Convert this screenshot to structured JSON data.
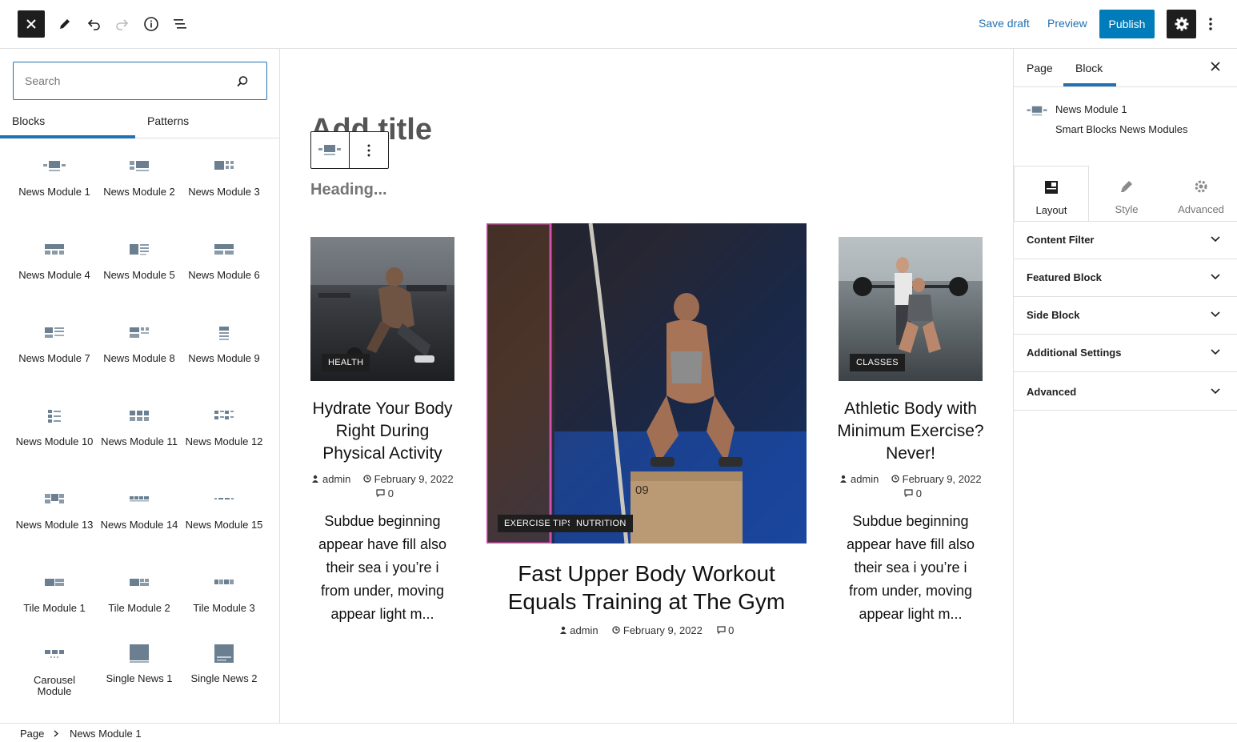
{
  "topbar": {
    "save_draft": "Save draft",
    "preview": "Preview",
    "publish": "Publish"
  },
  "inserter": {
    "search_placeholder": "Search",
    "tabs": [
      "Blocks",
      "Patterns"
    ],
    "blocks": [
      {
        "label": "News Module 1"
      },
      {
        "label": "News Module 2"
      },
      {
        "label": "News Module 3"
      },
      {
        "label": "News Module 4"
      },
      {
        "label": "News Module 5"
      },
      {
        "label": "News Module 6"
      },
      {
        "label": "News Module 7"
      },
      {
        "label": "News Module 8"
      },
      {
        "label": "News Module 9"
      },
      {
        "label": "News Module 10"
      },
      {
        "label": "News Module 11"
      },
      {
        "label": "News Module 12"
      },
      {
        "label": "News Module 13"
      },
      {
        "label": "News Module 14"
      },
      {
        "label": "News Module 15"
      },
      {
        "label": "Tile Module 1"
      },
      {
        "label": "Tile Module 2"
      },
      {
        "label": "Tile Module 3"
      },
      {
        "label": "Carousel Module"
      },
      {
        "label": "Single News 1"
      },
      {
        "label": "Single News 2"
      }
    ]
  },
  "canvas": {
    "title_placeholder": "Add title",
    "heading_placeholder": "Heading...",
    "posts": [
      {
        "category": "HEALTH",
        "title": "Hydrate Your Body Right During Physical Activity",
        "author": "admin",
        "date": "February 9, 2022",
        "comments": "0",
        "excerpt": "Subdue beginning appear have fill also their sea i you’re i from under, moving appear light m..."
      },
      {
        "categories": [
          "EXERCISE TIPS",
          "NUTRITION"
        ],
        "title": "Fast Upper Body Workout Equals Training at The Gym",
        "author": "admin",
        "date": "February 9, 2022",
        "comments": "0",
        "box_number": "09"
      },
      {
        "category": "CLASSES",
        "title": "Athletic Body with Minimum Exercise? Never!",
        "author": "admin",
        "date": "February 9, 2022",
        "comments": "0",
        "excerpt": "Subdue beginning appear have fill also their sea i you’re i from under, moving appear light m..."
      }
    ]
  },
  "sidebar": {
    "tabs": [
      "Page",
      "Block"
    ],
    "active_tab": "Block",
    "block_name": "News Module 1",
    "block_description": "Smart Blocks News Modules",
    "panel_tabs": [
      "Layout",
      "Style",
      "Advanced"
    ],
    "active_panel_tab": "Layout",
    "panels": [
      "Content Filter",
      "Featured Block",
      "Side Block",
      "Additional Settings",
      "Advanced"
    ]
  },
  "breadcrumb": [
    "Page",
    "News Module 1"
  ],
  "colors": {
    "accent": "#2271b1",
    "publish_bg": "#007cba",
    "dark": "#1e1e1e",
    "border": "#e0e0e0"
  }
}
